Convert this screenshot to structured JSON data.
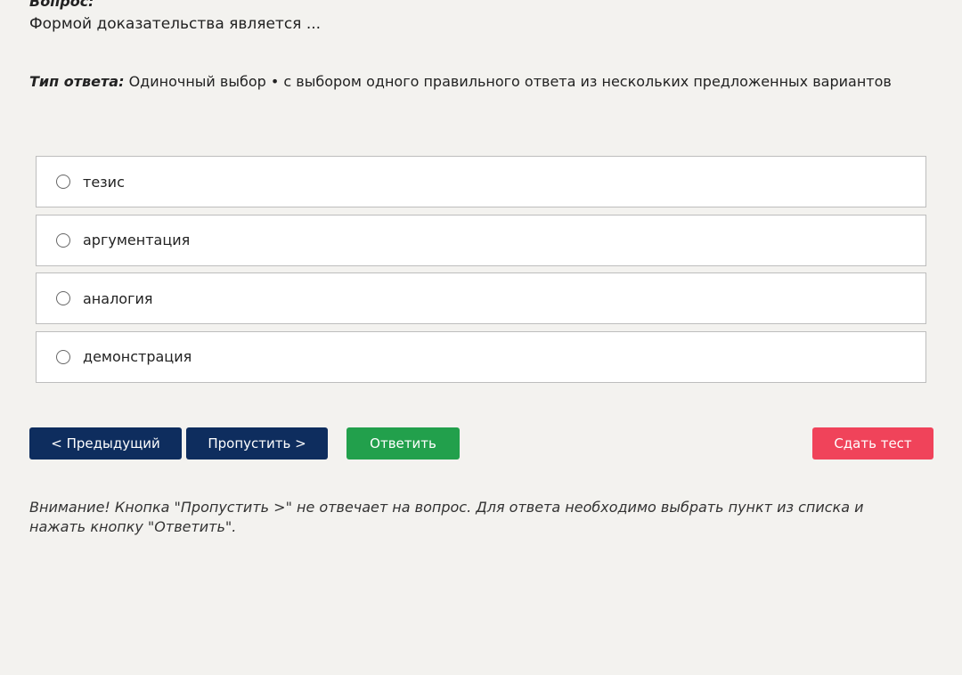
{
  "question": {
    "label": "Вопрос:",
    "text": "Формой доказательства является ..."
  },
  "answer_type": {
    "label": "Тип ответа:",
    "value": "Одиночный выбор • с выбором одного правильного ответа из нескольких предложенных вариантов"
  },
  "options": [
    {
      "label": "тезис"
    },
    {
      "label": "аргументация"
    },
    {
      "label": "аналогия"
    },
    {
      "label": "демонстрация"
    }
  ],
  "buttons": {
    "prev": "< Предыдущий",
    "skip": "Пропустить >",
    "answer": "Ответить",
    "submit": "Сдать тест"
  },
  "warning": "Внимание! Кнопка \"Пропустить >\" не отвечает на вопрос. Для ответа необходимо выбрать пункт из списка и нажать кнопку \"Ответить\".",
  "colors": {
    "background": "#f3f2ef",
    "primary_button": "#0e2d5e",
    "answer_button": "#22a04c",
    "submit_button": "#f0435a"
  }
}
